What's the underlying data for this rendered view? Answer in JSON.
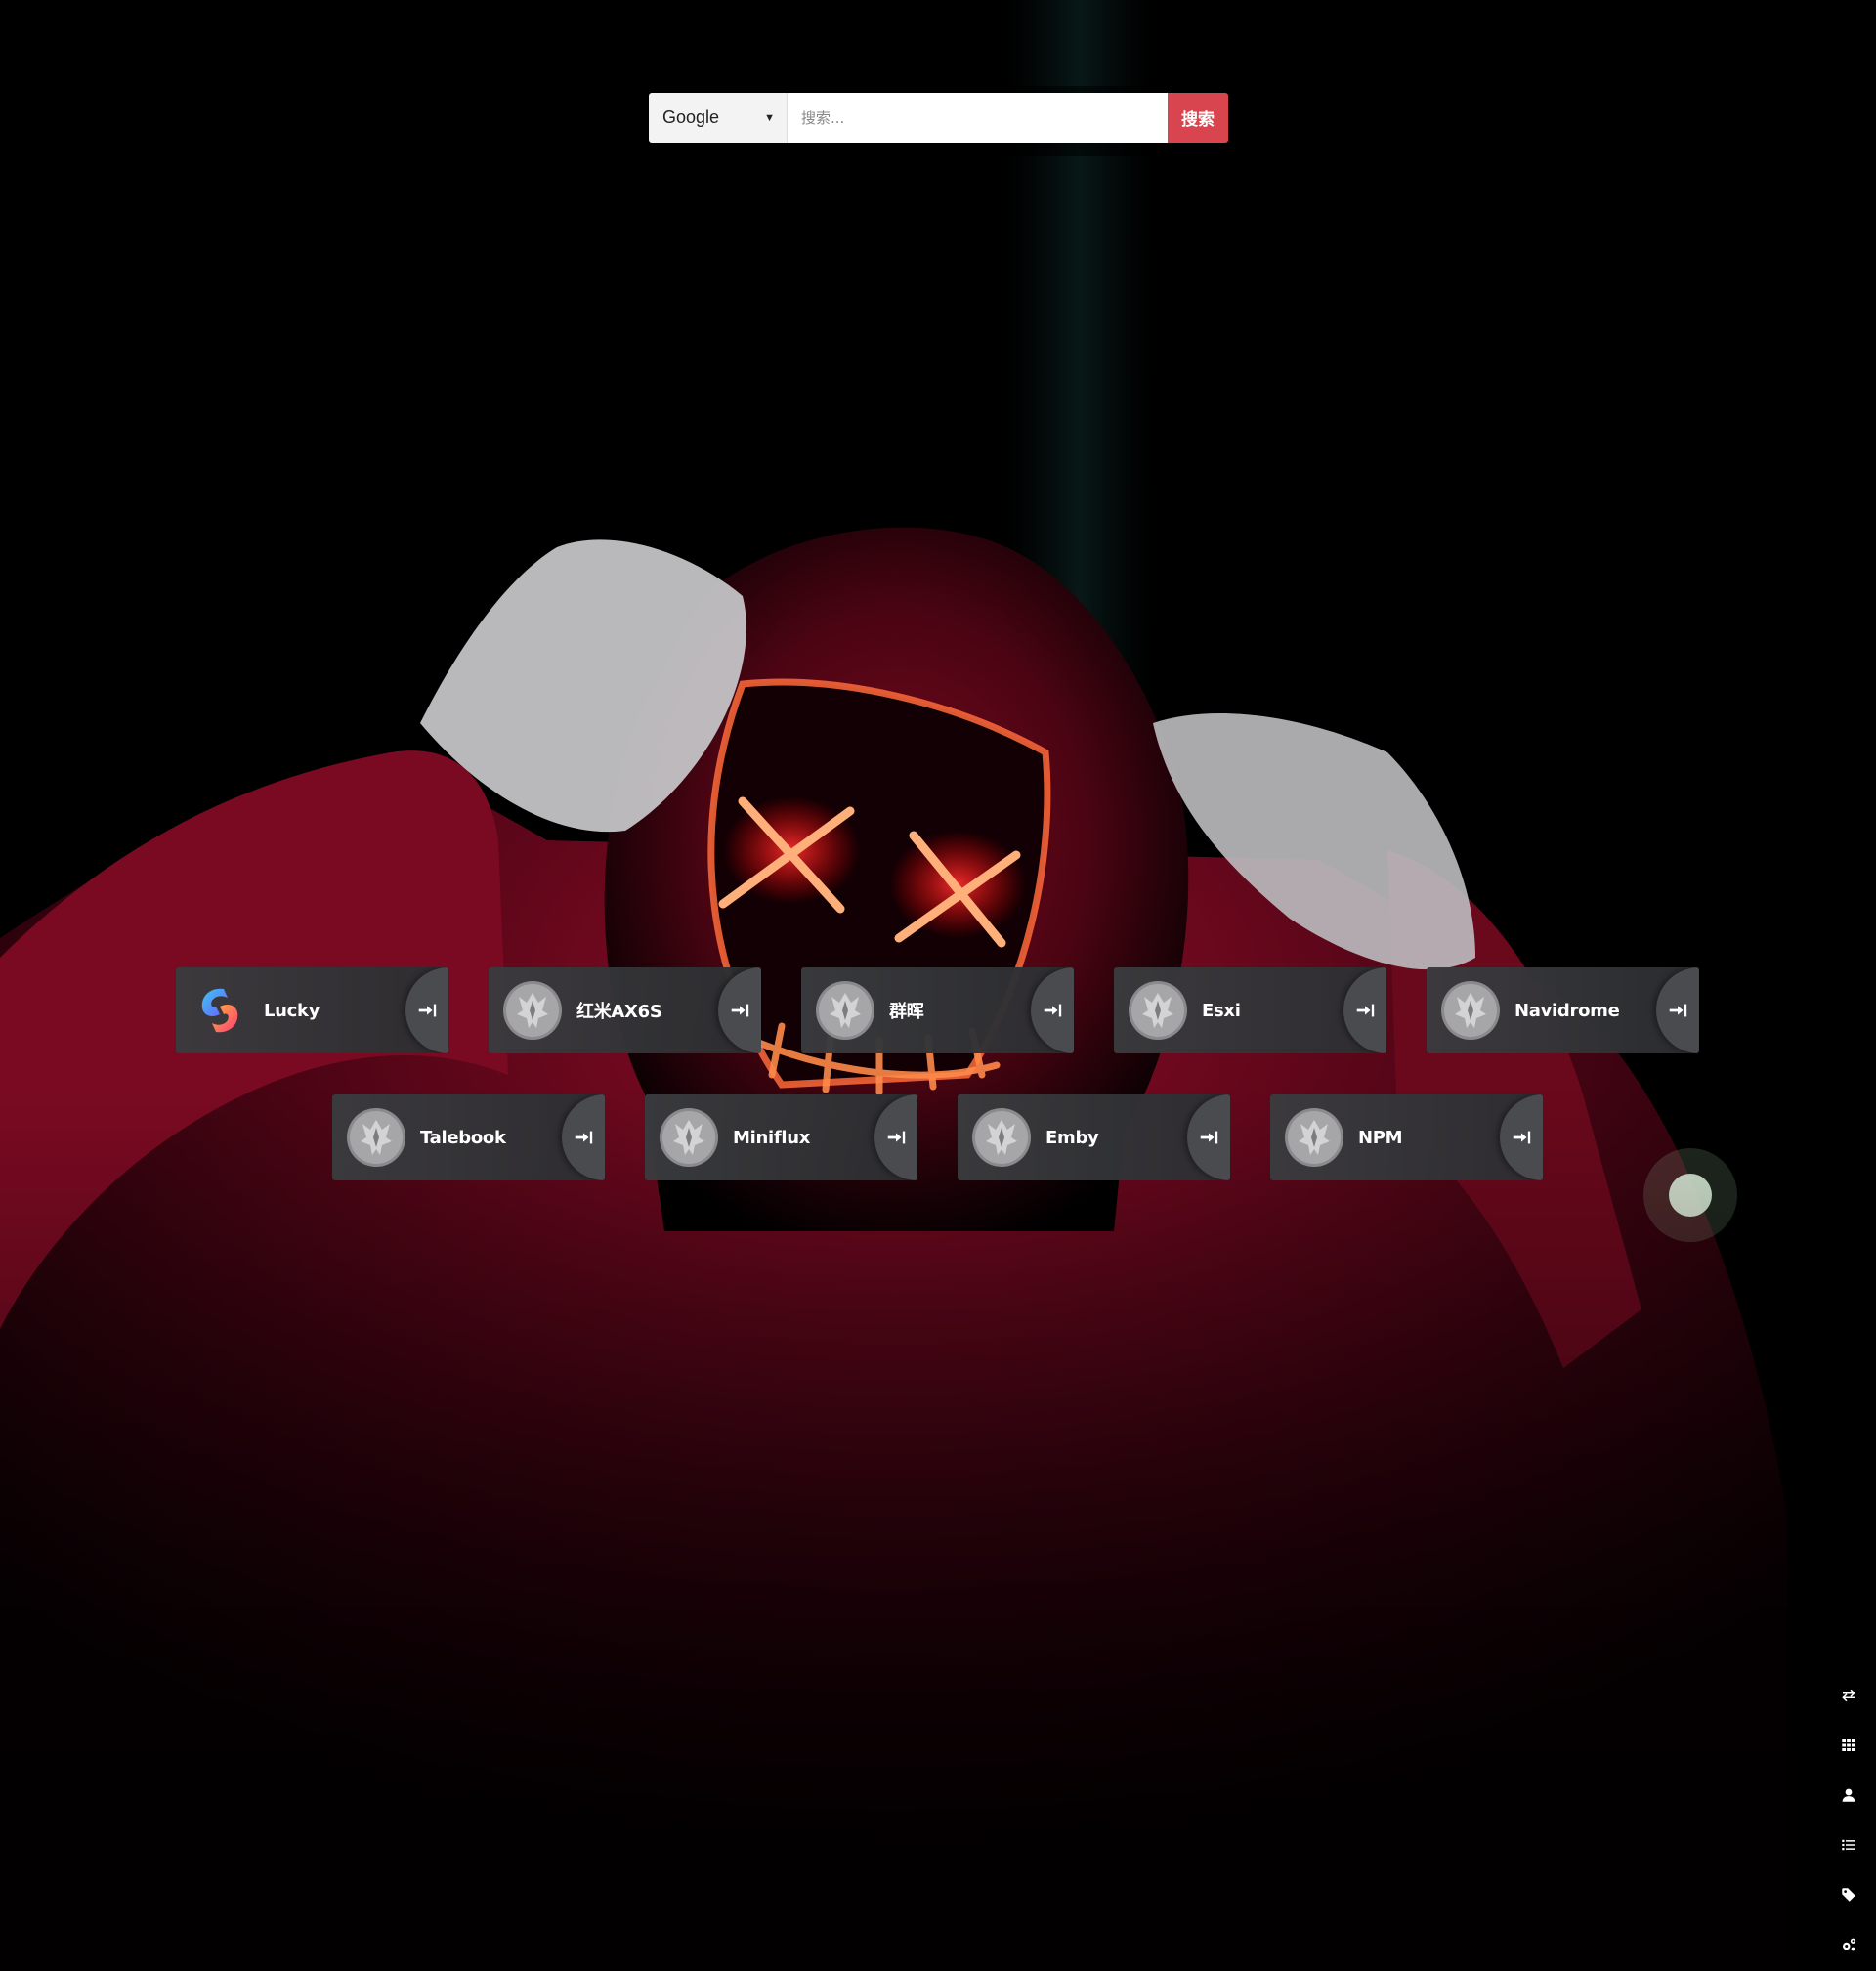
{
  "search": {
    "engine": "Google",
    "placeholder": "搜索...",
    "button_label": "搜索",
    "accent_color": "#d9454f"
  },
  "tiles_row1": [
    {
      "label": "Lucky",
      "icon": "lucky-logo-icon"
    },
    {
      "label": "红米AX6S",
      "icon": "default-app-icon"
    },
    {
      "label": "群晖",
      "icon": "default-app-icon"
    },
    {
      "label": "Esxi",
      "icon": "default-app-icon"
    },
    {
      "label": "Navidrome",
      "icon": "default-app-icon"
    }
  ],
  "tiles_row2": [
    {
      "label": "Talebook",
      "icon": "default-app-icon"
    },
    {
      "label": "Miniflux",
      "icon": "default-app-icon"
    },
    {
      "label": "Emby",
      "icon": "default-app-icon"
    },
    {
      "label": "NPM",
      "icon": "default-app-icon"
    }
  ],
  "tile_action_icon": "sign-in-icon",
  "side_toolbar": [
    {
      "icon": "swap-icon"
    },
    {
      "icon": "grid-icon"
    },
    {
      "icon": "user-icon"
    },
    {
      "icon": "list-icon"
    },
    {
      "icon": "tag-icon"
    },
    {
      "icon": "settings-icon"
    }
  ]
}
